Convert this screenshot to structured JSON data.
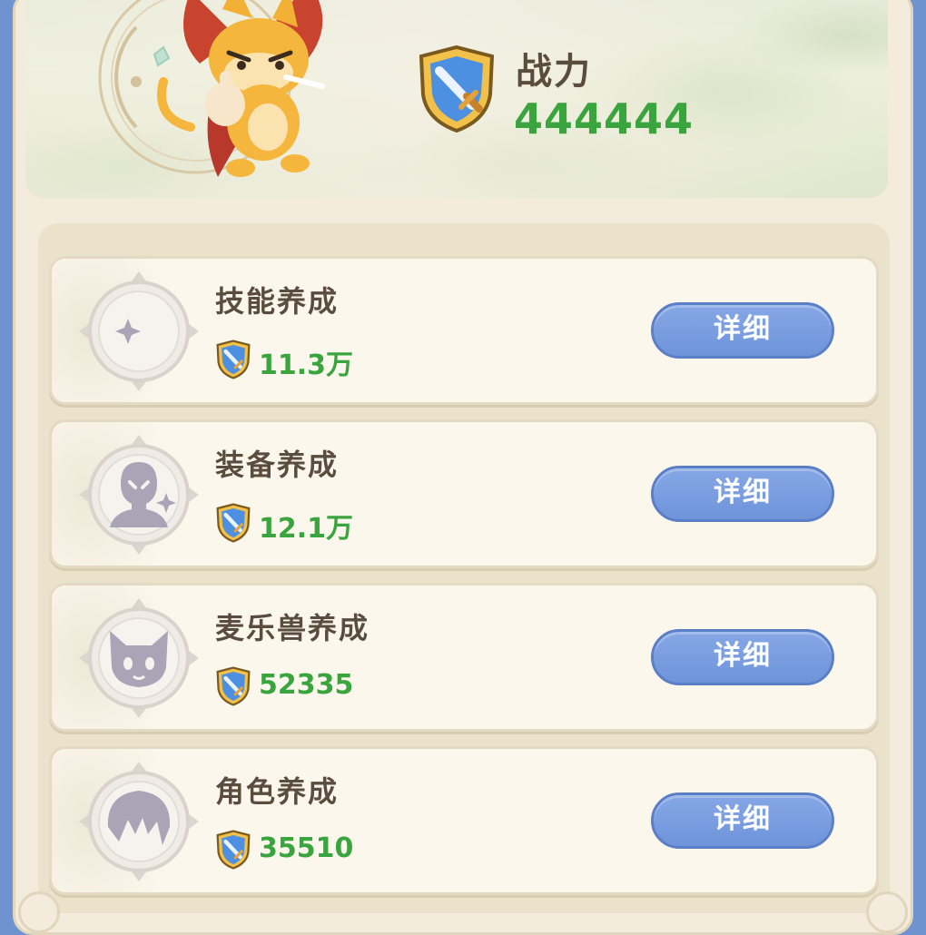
{
  "power": {
    "label": "战力",
    "value": "444444"
  },
  "items": [
    {
      "title": "技能养成",
      "value": "11.3万",
      "button": "详细",
      "icon": "moon-star-icon"
    },
    {
      "title": "装备养成",
      "value": "12.1万",
      "button": "详细",
      "icon": "cloaked-figure-icon"
    },
    {
      "title": "麦乐兽养成",
      "value": "52335",
      "button": "详细",
      "icon": "cat-face-icon"
    },
    {
      "title": "角色养成",
      "value": "35510",
      "button": "详细",
      "icon": "character-hair-icon"
    }
  ],
  "colors": {
    "value_green": "#3aa43e",
    "button_blue": "#7598dc",
    "title_brown": "#5a4d3f"
  }
}
